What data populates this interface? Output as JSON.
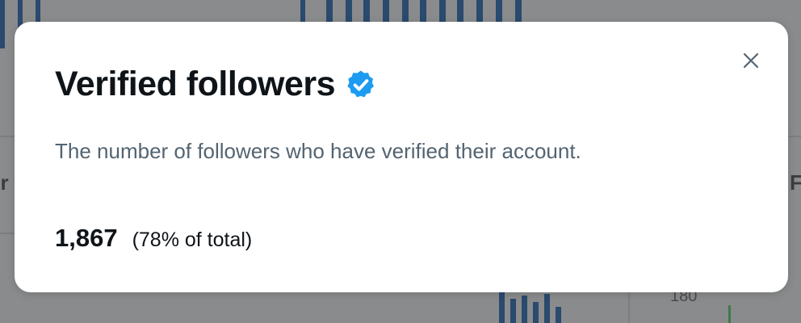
{
  "modal": {
    "title": "Verified followers",
    "description": "The number of followers who have verified their account.",
    "stat": {
      "value": "1,867",
      "percent_text": "(78% of total)",
      "percent": 78
    },
    "icons": {
      "verified": "verified-badge-icon",
      "close": "close-icon"
    }
  },
  "background": {
    "left_edge_text": "er",
    "right_edge_text": "F",
    "axis_tick": "180"
  },
  "colors": {
    "verified_blue": "#1d9bf0",
    "title_text": "#0f1419",
    "secondary_text": "#536471",
    "close_icon": "#536471"
  }
}
